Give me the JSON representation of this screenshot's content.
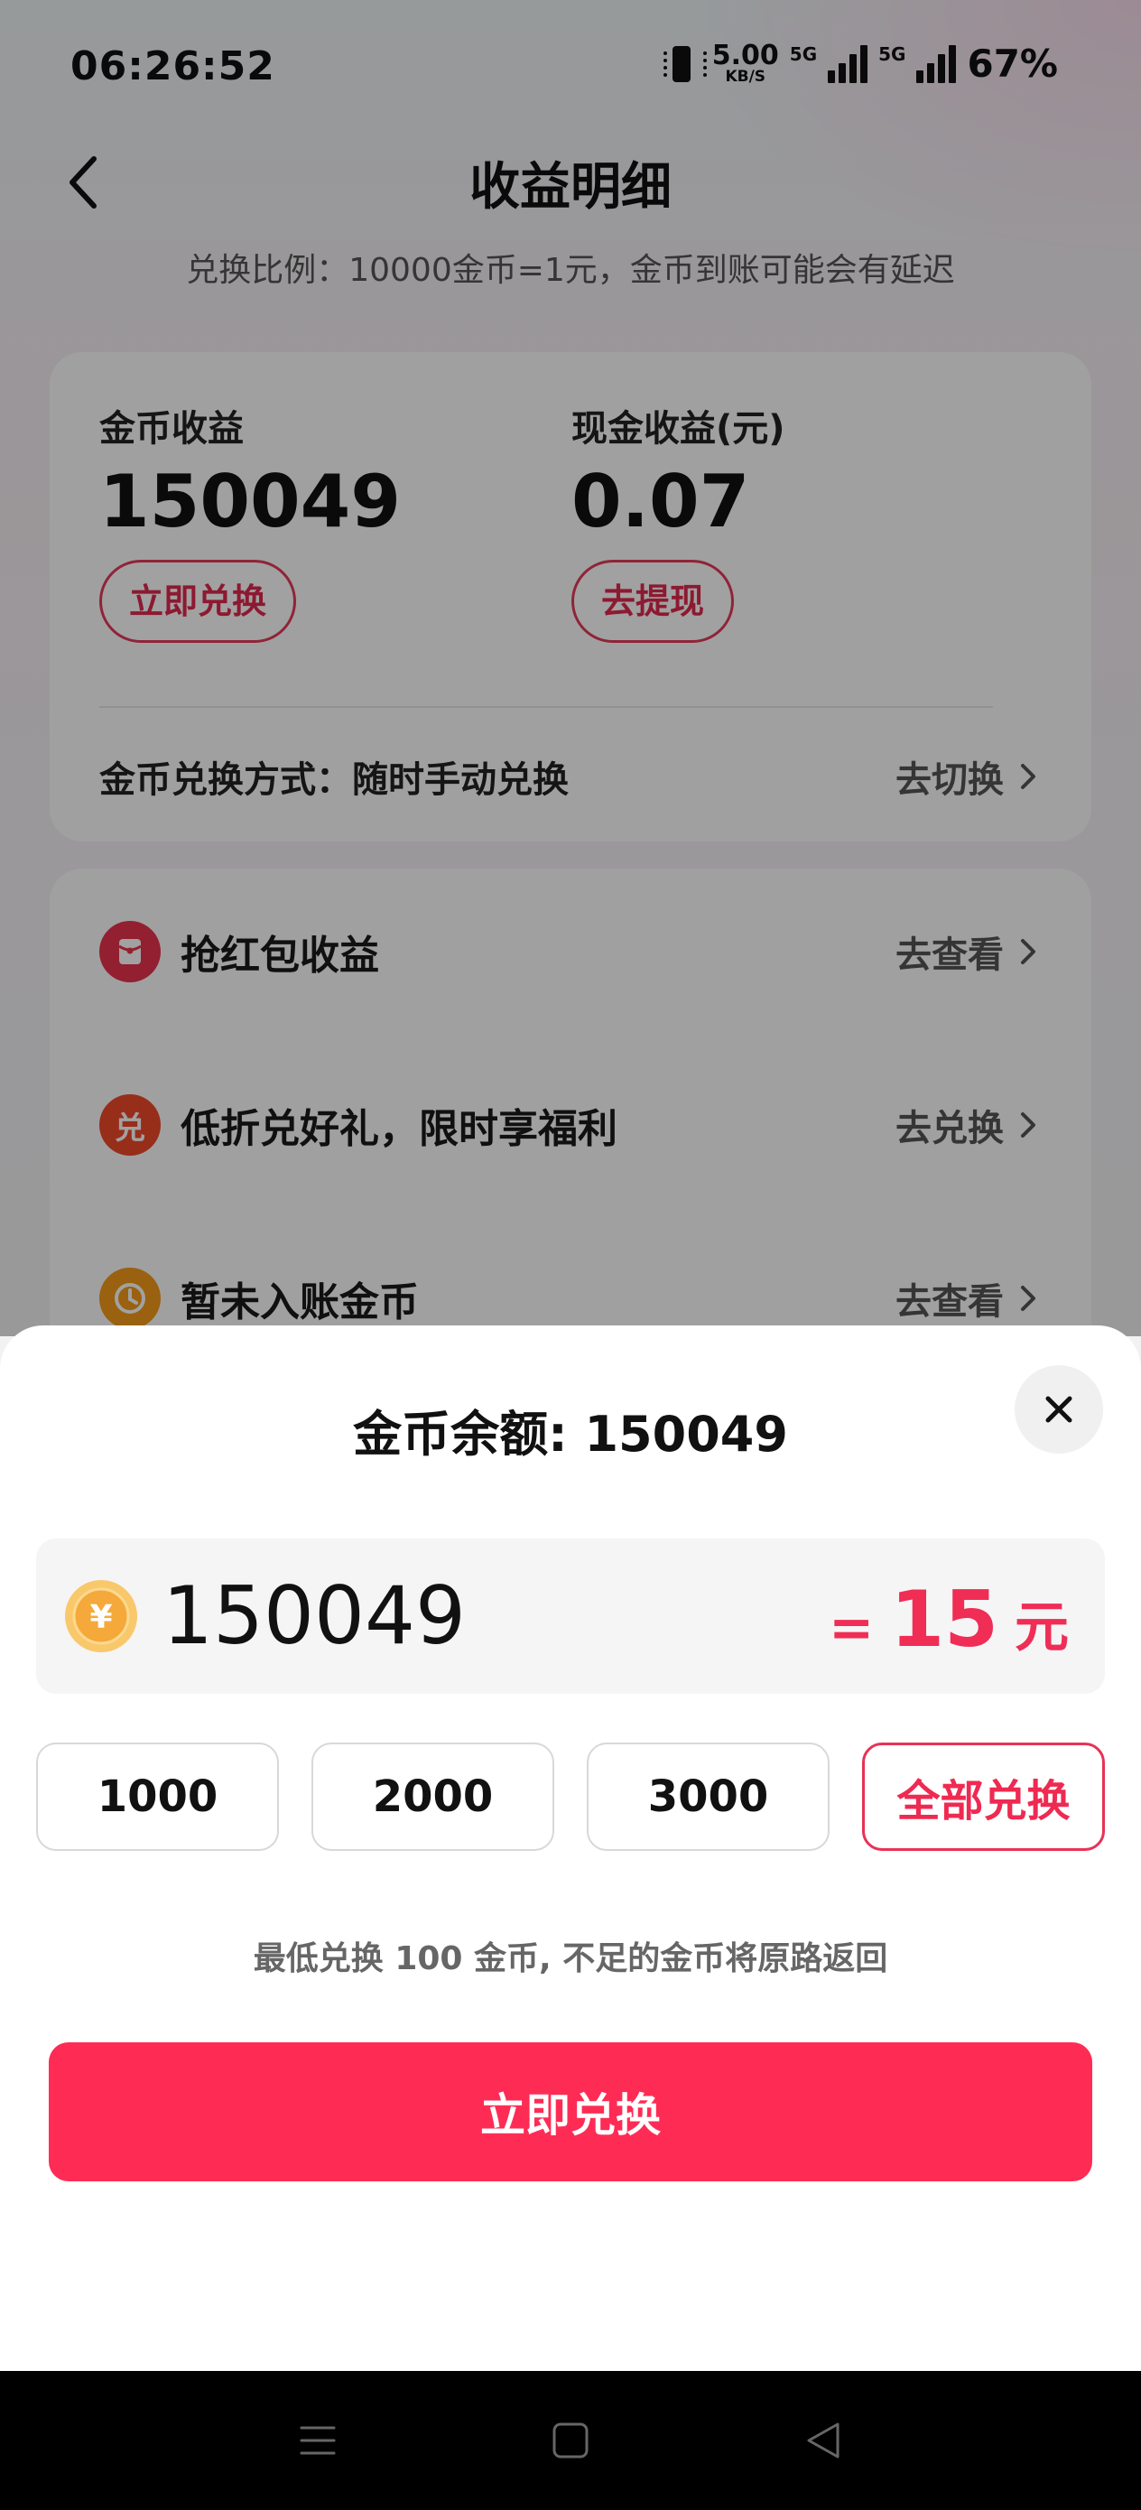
{
  "status_bar": {
    "time": "06:26:52",
    "speed_value": "5.00",
    "speed_unit": "KB/S",
    "net1": "5G",
    "net2": "5G",
    "battery": "67%"
  },
  "header": {
    "title": "收益明细",
    "subtitle": "兑换比例：10000金币=1元，金币到账可能会有延迟"
  },
  "earnings": {
    "coin_label": "金币收益",
    "coin_value": "150049",
    "coin_button": "立即兑换",
    "cash_label": "现金收益(元)",
    "cash_value": "0.07",
    "cash_button": "去提现",
    "method_text": "金币兑换方式：随时手动兑换",
    "method_link": "去切换"
  },
  "list": {
    "items": [
      {
        "icon": "red-packet-icon",
        "label": "抢红包收益",
        "action": "去查看",
        "color": "#e8344e"
      },
      {
        "icon": "exchange-icon",
        "glyph": "兑",
        "label": "低折兑好礼，限时享福利",
        "action": "去兑换",
        "color": "#ef4a2a"
      },
      {
        "icon": "clock-icon",
        "label": "暂未入账金币",
        "action": "去查看",
        "color": "#f39a1a"
      }
    ]
  },
  "sheet": {
    "title": "金币余额: 150049",
    "amount_value": "150049",
    "eq_sign": "=",
    "cash_amount": "15",
    "cash_unit": "元",
    "quick_options": [
      "1000",
      "2000",
      "3000",
      "全部兑换"
    ],
    "note": "最低兑换 100 金币, 不足的金币将原路返回",
    "confirm_button": "立即兑换",
    "coin_glyph": "¥"
  },
  "colors": {
    "accent": "#fe2c55",
    "accent_text": "#e0284f"
  }
}
